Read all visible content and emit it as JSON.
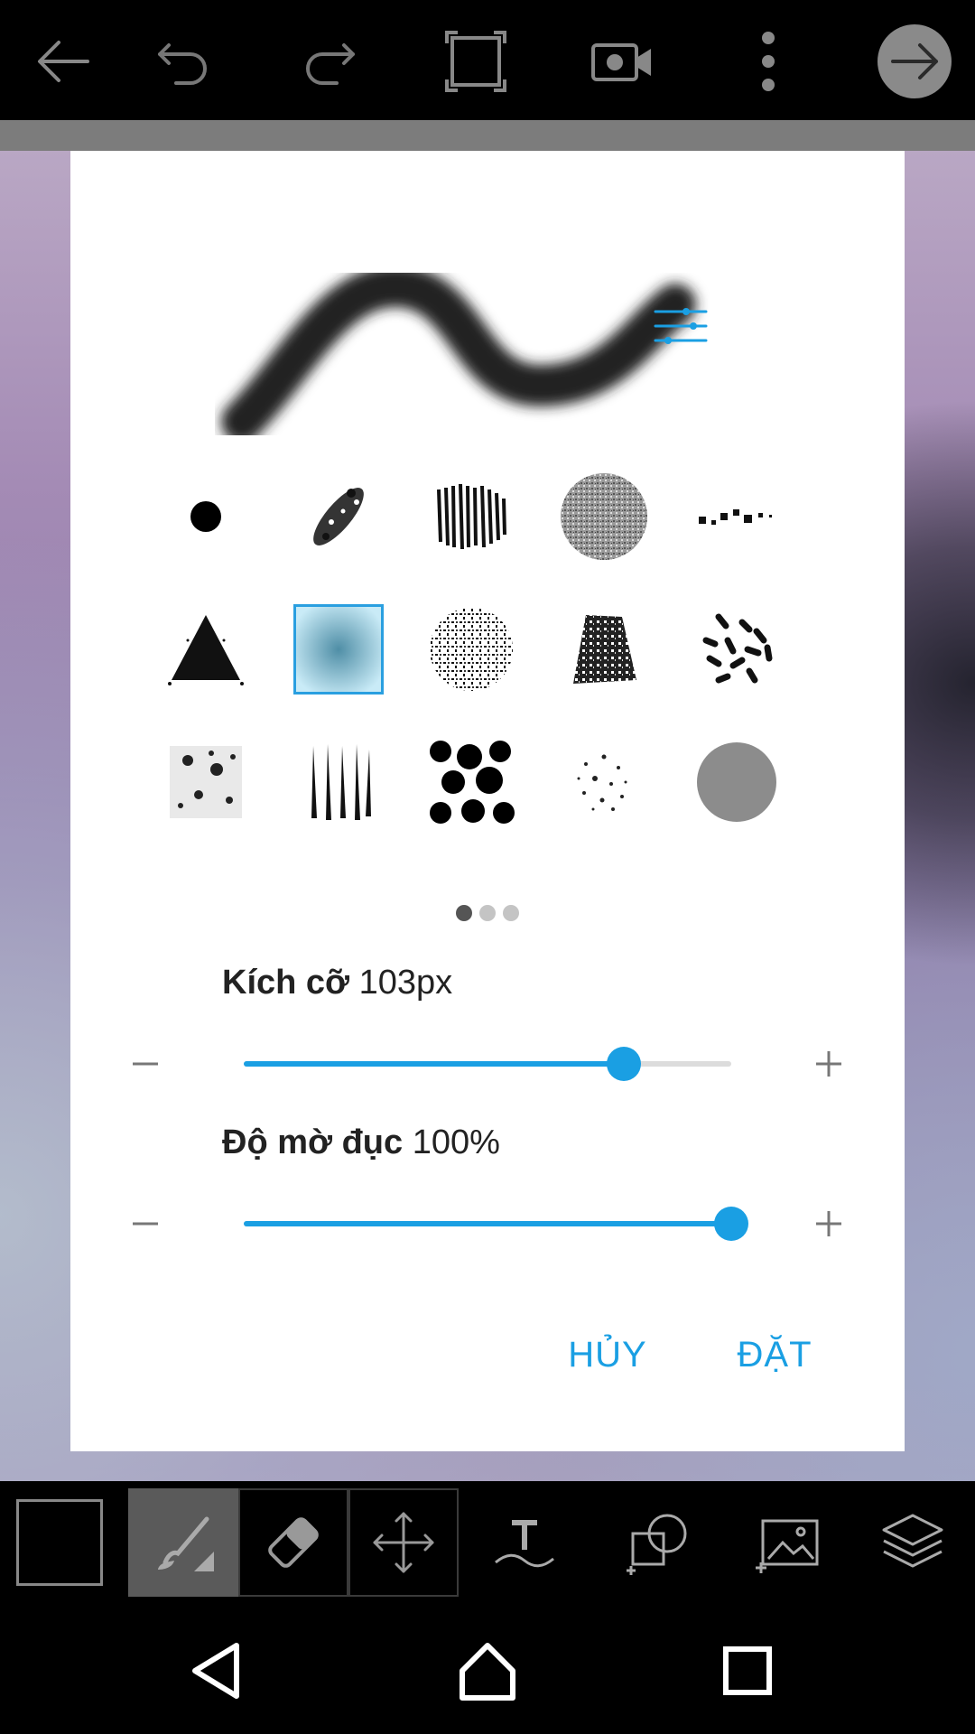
{
  "top_toolbar": {
    "icons": [
      "back-arrow-icon",
      "undo-icon",
      "redo-icon",
      "crop-fit-icon",
      "video-camera-icon",
      "more-vert-icon",
      "next-arrow-icon"
    ]
  },
  "brush_dialog": {
    "settings_icon": "sliders-icon",
    "brushes": [
      "round-hard",
      "chalk-diagonal",
      "charcoal-scribble",
      "noise-circle",
      "dotted-line",
      "spray-triangle",
      "soft-airbrush",
      "speckle-circle",
      "crumble-blob",
      "scatter-dashes",
      "grunge-square",
      "vertical-strokes",
      "ink-splatter",
      "fine-spray",
      "flat-gray-circle"
    ],
    "selected_brush_index": 6,
    "pager": {
      "pages": 3,
      "active": 0
    },
    "size": {
      "label": "Kích cỡ",
      "value": "103px",
      "level": 0.78
    },
    "opacity": {
      "label": "Độ mờ đục",
      "value": "100%",
      "level": 1.0
    },
    "cancel_label": "HỦY",
    "ok_label": "ĐẶT"
  },
  "bottom_toolbar": {
    "tools": [
      "brush-icon",
      "eraser-icon",
      "move-icon",
      "text-icon",
      "shape-add-icon",
      "add-photo-icon",
      "layers-icon"
    ],
    "active_tool": "brush-icon"
  },
  "nav_bar": {
    "icons": [
      "nav-back-icon",
      "nav-home-icon",
      "nav-recents-icon"
    ]
  },
  "colors": {
    "accent": "#1a9fe3",
    "toolbar_bg": "#000000",
    "dialog_bg": "#ffffff"
  }
}
